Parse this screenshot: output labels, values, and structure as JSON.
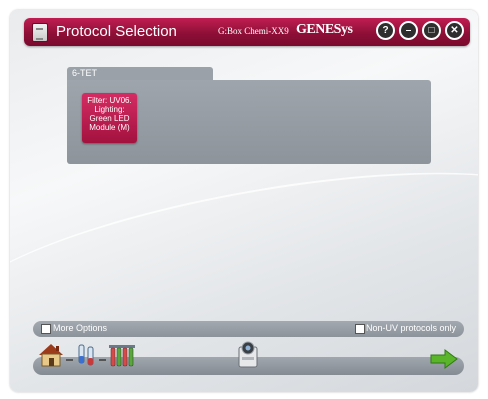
{
  "titlebar": {
    "title": "Protocol Selection",
    "model": "G:Box Chemi-XX9",
    "brand": "GENESys",
    "help_label": "?",
    "minimize_label": "–",
    "maximize_label": "□",
    "close_label": "✕"
  },
  "protocols": {
    "tab_label": "6-TET",
    "items": [
      {
        "lines": [
          "Filter: UV06.",
          "Lighting:",
          "Green LED",
          "Module (M)"
        ]
      }
    ]
  },
  "options": {
    "more_options_label": "More Options",
    "non_uv_label": "Non-UV protocols only"
  },
  "wizard": {
    "steps": [
      "home-icon",
      "sample-tube-icon",
      "tube-rack-icon",
      "camera-icon",
      "next-arrow-icon"
    ]
  },
  "colors": {
    "accent": "#a3123f",
    "panel": "#9aa1a8",
    "next_arrow": "#5ab52a"
  }
}
